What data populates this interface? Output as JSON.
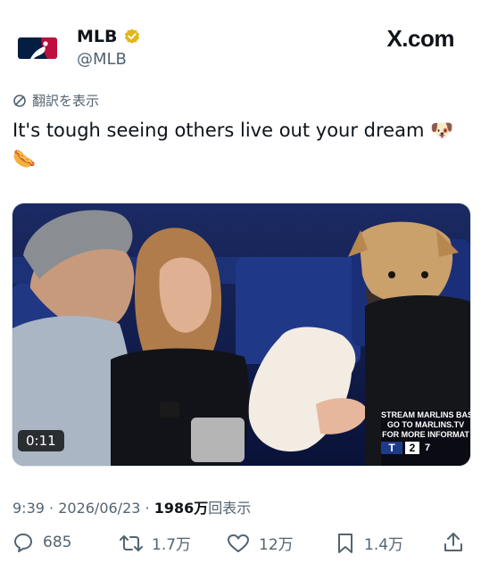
{
  "header": {
    "name": "MLB",
    "handle": "@MLB",
    "site": "X.com",
    "colors": {
      "verified": "#e2b719",
      "mlb_blue": "#041e42",
      "mlb_red": "#bf0d3e"
    }
  },
  "translate_label": "翻訳を表示",
  "tweet": {
    "text": "It's tough seeing others live out your dream 🐶",
    "text_line2": "🌭"
  },
  "video": {
    "duration": "0:11",
    "scorebug": {
      "line1": "STREAM MARLINS BAS",
      "line2": "GO TO MARLINS.TV",
      "line3": "FOR MORE INFORMAT",
      "team": "T",
      "score": "2",
      "extra": "7"
    }
  },
  "meta": {
    "time": "9:39",
    "date": "2026/06/23",
    "views_count": "1986万",
    "views_label": "回表示"
  },
  "actions": {
    "replies": "685",
    "reposts": "1.7万",
    "likes": "12万",
    "bookmarks": "1.4万"
  }
}
